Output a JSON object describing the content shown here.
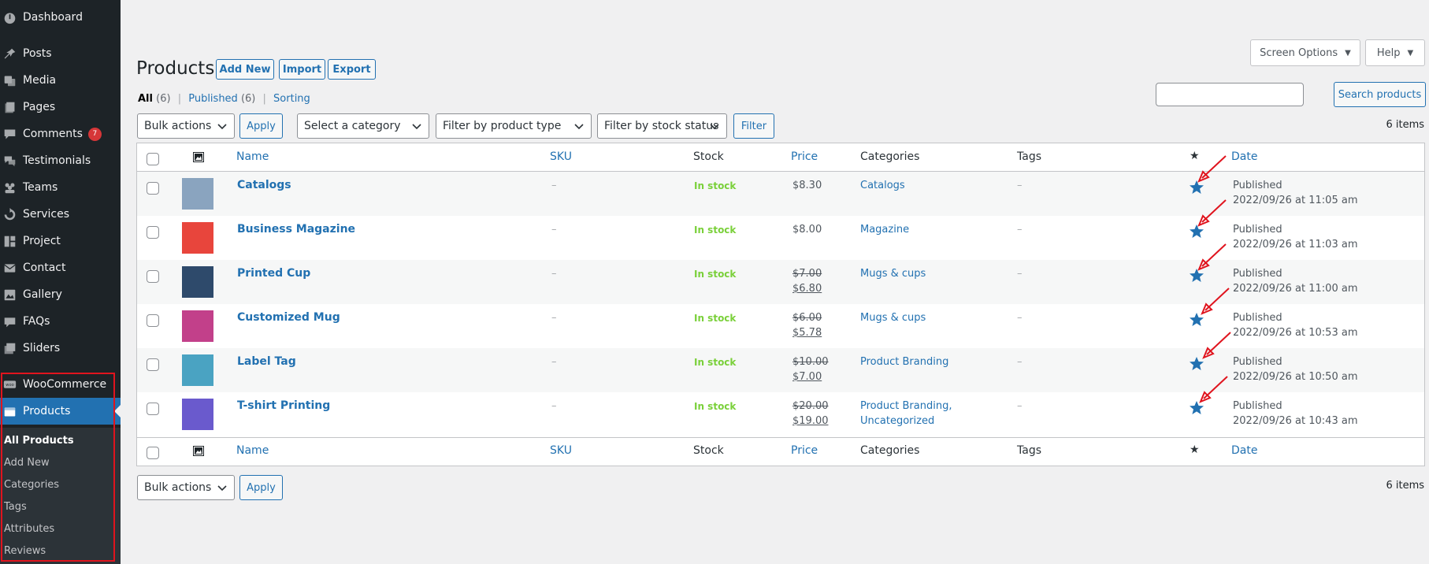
{
  "sidebar": {
    "items": [
      {
        "label": "Dashboard",
        "icon": "dashboard-icon"
      },
      {
        "label": "Posts",
        "icon": "pin-icon"
      },
      {
        "label": "Media",
        "icon": "media-icon"
      },
      {
        "label": "Pages",
        "icon": "pages-icon"
      },
      {
        "label": "Comments",
        "icon": "comments-icon",
        "badge": "7"
      },
      {
        "label": "Testimonials",
        "icon": "testimonials-icon"
      },
      {
        "label": "Teams",
        "icon": "teams-icon"
      },
      {
        "label": "Services",
        "icon": "services-icon"
      },
      {
        "label": "Project",
        "icon": "project-icon"
      },
      {
        "label": "Contact",
        "icon": "contact-icon"
      },
      {
        "label": "Gallery",
        "icon": "gallery-icon"
      },
      {
        "label": "FAQs",
        "icon": "faqs-icon"
      },
      {
        "label": "Sliders",
        "icon": "sliders-icon"
      },
      {
        "label": "WooCommerce",
        "icon": "woocommerce-icon"
      },
      {
        "label": "Products",
        "icon": "products-icon"
      }
    ],
    "submenu": [
      "All Products",
      "Add New",
      "Categories",
      "Tags",
      "Attributes",
      "Reviews"
    ]
  },
  "top": {
    "screen_options": "Screen Options",
    "help": "Help"
  },
  "header": {
    "title": "Products",
    "add_new": "Add New",
    "import": "Import",
    "export": "Export"
  },
  "views": {
    "all": "All",
    "all_count": "(6)",
    "published": "Published",
    "published_count": "(6)",
    "sorting": "Sorting",
    "separator": "|"
  },
  "search": {
    "placeholder": "",
    "button": "Search products"
  },
  "filters": {
    "bulk_actions": "Bulk actions",
    "apply": "Apply",
    "category": "Select a category",
    "product_type": "Filter by product type",
    "stock_status": "Filter by stock status",
    "filter": "Filter",
    "items_count": "6 items"
  },
  "columns": {
    "name": "Name",
    "sku": "SKU",
    "stock": "Stock",
    "price": "Price",
    "categories": "Categories",
    "tags": "Tags",
    "date": "Date"
  },
  "products": [
    {
      "name": "Catalogs",
      "sku": "–",
      "stock": "In stock",
      "price": "$8.30",
      "sale_price": "",
      "categories": "Catalogs",
      "categories2": "",
      "tags": "–",
      "status": "Published",
      "date": "2022/09/26 at 11:05 am",
      "thumb_color": "#8aa4bf"
    },
    {
      "name": "Business Magazine",
      "sku": "–",
      "stock": "In stock",
      "price": "$8.00",
      "sale_price": "",
      "categories": "Magazine",
      "categories2": "",
      "tags": "–",
      "status": "Published",
      "date": "2022/09/26 at 11:03 am",
      "thumb_color": "#e8453c"
    },
    {
      "name": "Printed Cup",
      "sku": "–",
      "stock": "In stock",
      "price": "$7.00",
      "sale_price": "$6.80",
      "categories": "Mugs & cups",
      "categories2": "",
      "tags": "–",
      "status": "Published",
      "date": "2022/09/26 at 11:00 am",
      "thumb_color": "#2e4a6b"
    },
    {
      "name": "Customized Mug",
      "sku": "–",
      "stock": "In stock",
      "price": "$6.00",
      "sale_price": "$5.78",
      "categories": "Mugs & cups",
      "categories2": "",
      "tags": "–",
      "status": "Published",
      "date": "2022/09/26 at 10:53 am",
      "thumb_color": "#c2408a"
    },
    {
      "name": "Label Tag",
      "sku": "–",
      "stock": "In stock",
      "price": "$10.00",
      "sale_price": "$7.00",
      "categories": "Product Branding",
      "categories2": "",
      "tags": "–",
      "status": "Published",
      "date": "2022/09/26 at 10:50 am",
      "thumb_color": "#4aa3c2"
    },
    {
      "name": "T-shirt Printing",
      "sku": "–",
      "stock": "In stock",
      "price": "$20.00",
      "sale_price": "$19.00",
      "categories": "Product Branding,",
      "categories2": "Uncategorized",
      "tags": "–",
      "status": "Published",
      "date": "2022/09/26 at 10:43 am",
      "thumb_color": "#6a5acd"
    }
  ],
  "colors": {
    "accent": "#2271b1",
    "sidebar": "#1d2327",
    "in_stock": "#7ad03a",
    "annotation": "#e0141e",
    "featured_star": "#2271b1"
  }
}
